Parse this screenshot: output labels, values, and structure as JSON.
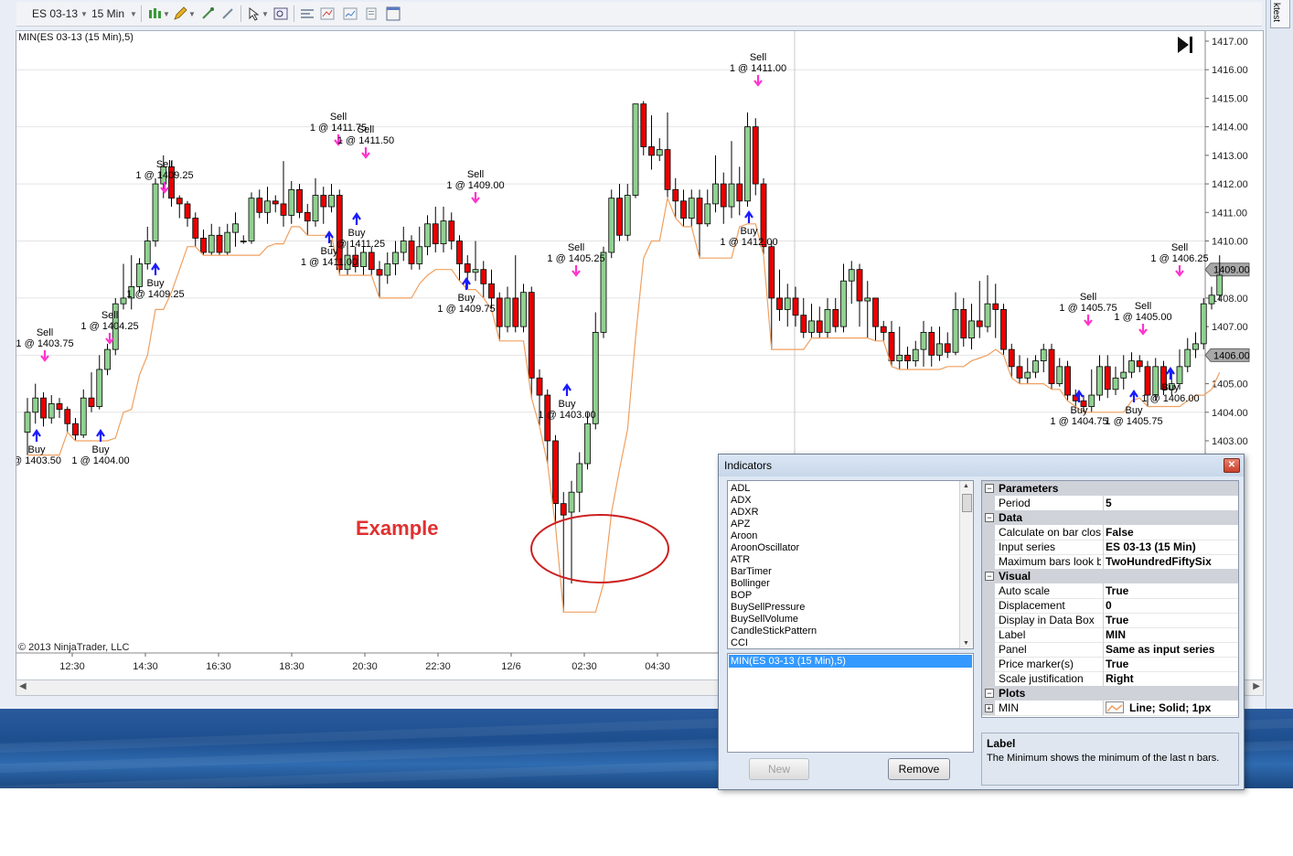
{
  "toolbar": {
    "instrument": "ES 03-13",
    "interval": "15 Min"
  },
  "right_tab": "ktest",
  "chart": {
    "indicator_label": "MIN(ES 03-13 (15 Min),5)",
    "copyright": "© 2013 NinjaTrader, LLC",
    "watermark": "Example",
    "price_ticks": [
      "1417.00",
      "1416.00",
      "1415.00",
      "1414.00",
      "1413.00",
      "1412.00",
      "1411.00",
      "1410.00",
      "1409.00",
      "1408.00",
      "1407.00",
      "1406.00",
      "1405.00",
      "1404.00",
      "1403.00"
    ],
    "price_markers": [
      "1409.00",
      "1406.00"
    ],
    "time_ticks": [
      "12:30",
      "14:30",
      "16:30",
      "18:30",
      "20:30",
      "22:30",
      "12/6",
      "02:30",
      "04:30"
    ],
    "trade_labels": [
      {
        "l1": "Sell",
        "l2": "1 @ 1403.75"
      },
      {
        "l1": "Buy",
        "l2": "@ 1403.50"
      },
      {
        "l1": "Buy",
        "l2": "1 @ 1404.00"
      },
      {
        "l1": "Sell",
        "l2": "1 @ 1404.25"
      },
      {
        "l1": "Sell",
        "l2": "1 @ 1409.25"
      },
      {
        "l1": "Buy",
        "l2": "1 @ 1409.25"
      },
      {
        "l1": "Sell",
        "l2": "1 @ 1411.75"
      },
      {
        "l1": "Sell",
        "l2": "1 @ 1411.50"
      },
      {
        "l1": "Buy",
        "l2": "1 @ 1411.00"
      },
      {
        "l1": "Buy",
        "l2": "1 @ 1411.25"
      },
      {
        "l1": "Sell",
        "l2": "1 @ 1409.00"
      },
      {
        "l1": "Buy",
        "l2": "1 @ 1409.75"
      },
      {
        "l1": "Sell",
        "l2": "1 @ 1405.25"
      },
      {
        "l1": "Buy",
        "l2": "1 @ 1403.00"
      },
      {
        "l1": "Sell",
        "l2": "1 @ 1411.00"
      },
      {
        "l1": "Buy",
        "l2": "1 @ 1412.00"
      },
      {
        "l1": "Sell",
        "l2": "1 @ 1405.75"
      },
      {
        "l1": "Buy",
        "l2": "1 @ 1404.75"
      },
      {
        "l1": "Sell",
        "l2": "1 @ 1405.00"
      },
      {
        "l1": "Buy",
        "l2": "1 @ 1405.75"
      },
      {
        "l1": "Sell",
        "l2": "1 @ 1406.25"
      },
      {
        "l1": "Buy",
        "l2": "1 @ 1406.00"
      }
    ],
    "colors": {
      "up": "#8fd18f",
      "down": "#e60000",
      "min_line": "#f0a060",
      "sell_arrow": "#ff33cc",
      "buy_arrow": "#1a1aff"
    }
  },
  "chart_data": {
    "type": "candlestick",
    "instrument": "ES 03-13",
    "interval": "15 Min",
    "ylim": [
      1402.5,
      1417.2
    ],
    "bars": [
      {
        "o": 1403.3,
        "c": 1404.0,
        "h": 1404.5,
        "l": 1402.5
      },
      {
        "o": 1404.0,
        "c": 1404.5,
        "h": 1405.0,
        "l": 1403.6
      },
      {
        "o": 1404.5,
        "c": 1403.8,
        "h": 1404.7,
        "l": 1403.5
      },
      {
        "o": 1403.8,
        "c": 1404.3,
        "h": 1404.6,
        "l": 1403.6
      },
      {
        "o": 1404.3,
        "c": 1404.1,
        "h": 1404.5,
        "l": 1403.8
      },
      {
        "o": 1404.1,
        "c": 1403.6,
        "h": 1404.2,
        "l": 1403.3
      },
      {
        "o": 1403.6,
        "c": 1403.2,
        "h": 1403.8,
        "l": 1403.0
      },
      {
        "o": 1403.2,
        "c": 1404.5,
        "h": 1404.8,
        "l": 1403.1
      },
      {
        "o": 1404.5,
        "c": 1404.2,
        "h": 1405.4,
        "l": 1404.0
      },
      {
        "o": 1404.2,
        "c": 1405.5,
        "h": 1406.0,
        "l": 1404.1
      },
      {
        "o": 1405.5,
        "c": 1406.2,
        "h": 1406.4,
        "l": 1405.3
      },
      {
        "o": 1406.2,
        "c": 1407.8,
        "h": 1408.0,
        "l": 1406.0
      },
      {
        "o": 1407.8,
        "c": 1408.0,
        "h": 1409.2,
        "l": 1407.6
      },
      {
        "o": 1408.0,
        "c": 1408.4,
        "h": 1409.5,
        "l": 1407.6
      },
      {
        "o": 1408.4,
        "c": 1409.2,
        "h": 1409.4,
        "l": 1408.2
      },
      {
        "o": 1409.2,
        "c": 1410.0,
        "h": 1410.5,
        "l": 1409.0
      },
      {
        "o": 1410.0,
        "c": 1412.0,
        "h": 1412.2,
        "l": 1409.8
      },
      {
        "o": 1412.0,
        "c": 1412.6,
        "h": 1413.0,
        "l": 1411.5
      },
      {
        "o": 1412.6,
        "c": 1411.5,
        "h": 1412.8,
        "l": 1411.2
      },
      {
        "o": 1411.5,
        "c": 1411.3,
        "h": 1411.6,
        "l": 1410.8
      },
      {
        "o": 1411.3,
        "c": 1410.8,
        "h": 1411.4,
        "l": 1410.5
      },
      {
        "o": 1410.8,
        "c": 1410.1,
        "h": 1411.0,
        "l": 1409.8
      },
      {
        "o": 1410.1,
        "c": 1409.6,
        "h": 1410.4,
        "l": 1409.5
      },
      {
        "o": 1409.6,
        "c": 1410.2,
        "h": 1410.6,
        "l": 1409.5
      },
      {
        "o": 1410.2,
        "c": 1409.6,
        "h": 1410.5,
        "l": 1409.5
      },
      {
        "o": 1409.6,
        "c": 1410.3,
        "h": 1410.6,
        "l": 1409.5
      },
      {
        "o": 1410.3,
        "c": 1410.6,
        "h": 1411.0,
        "l": 1409.8
      },
      {
        "o": 1410.0,
        "c": 1410.0,
        "h": 1410.2,
        "l": 1409.9
      },
      {
        "o": 1410.0,
        "c": 1411.5,
        "h": 1411.7,
        "l": 1409.9
      },
      {
        "o": 1411.5,
        "c": 1411.0,
        "h": 1411.8,
        "l": 1410.8
      },
      {
        "o": 1411.0,
        "c": 1411.4,
        "h": 1411.9,
        "l": 1410.6
      },
      {
        "o": 1411.4,
        "c": 1411.3,
        "h": 1411.6,
        "l": 1411.0
      },
      {
        "o": 1411.3,
        "c": 1410.9,
        "h": 1412.8,
        "l": 1410.5
      },
      {
        "o": 1410.9,
        "c": 1411.8,
        "h": 1412.1,
        "l": 1410.6
      },
      {
        "o": 1411.8,
        "c": 1411.0,
        "h": 1412.0,
        "l": 1410.8
      },
      {
        "o": 1411.0,
        "c": 1410.7,
        "h": 1411.3,
        "l": 1410.2
      },
      {
        "o": 1410.7,
        "c": 1411.6,
        "h": 1412.2,
        "l": 1410.5
      },
      {
        "o": 1411.6,
        "c": 1411.2,
        "h": 1411.9,
        "l": 1410.6
      },
      {
        "o": 1411.2,
        "c": 1411.6,
        "h": 1412.0,
        "l": 1411.0
      },
      {
        "o": 1411.6,
        "c": 1409.0,
        "h": 1411.8,
        "l": 1408.8
      },
      {
        "o": 1409.0,
        "c": 1409.5,
        "h": 1410.0,
        "l": 1408.8
      },
      {
        "o": 1409.5,
        "c": 1409.1,
        "h": 1409.8,
        "l": 1408.9
      },
      {
        "o": 1409.1,
        "c": 1409.6,
        "h": 1409.8,
        "l": 1408.8
      },
      {
        "o": 1409.6,
        "c": 1409.0,
        "h": 1409.8,
        "l": 1408.8
      },
      {
        "o": 1409.0,
        "c": 1408.8,
        "h": 1409.3,
        "l": 1408.0
      },
      {
        "o": 1408.8,
        "c": 1409.2,
        "h": 1409.6,
        "l": 1408.5
      },
      {
        "o": 1409.2,
        "c": 1409.6,
        "h": 1410.0,
        "l": 1408.8
      },
      {
        "o": 1409.6,
        "c": 1410.0,
        "h": 1410.5,
        "l": 1409.3
      },
      {
        "o": 1410.0,
        "c": 1409.2,
        "h": 1410.2,
        "l": 1409.0
      },
      {
        "o": 1409.2,
        "c": 1409.8,
        "h": 1410.5,
        "l": 1409.0
      },
      {
        "o": 1409.8,
        "c": 1410.6,
        "h": 1410.9,
        "l": 1409.5
      },
      {
        "o": 1410.6,
        "c": 1409.9,
        "h": 1411.2,
        "l": 1409.6
      },
      {
        "o": 1409.9,
        "c": 1410.7,
        "h": 1411.2,
        "l": 1409.6
      },
      {
        "o": 1410.7,
        "c": 1410.0,
        "h": 1411.0,
        "l": 1409.7
      },
      {
        "o": 1410.0,
        "c": 1409.2,
        "h": 1410.2,
        "l": 1408.6
      },
      {
        "o": 1409.2,
        "c": 1408.9,
        "h": 1409.5,
        "l": 1408.3
      },
      {
        "o": 1408.9,
        "c": 1409.0,
        "h": 1410.0,
        "l": 1408.6
      },
      {
        "o": 1409.0,
        "c": 1408.5,
        "h": 1409.3,
        "l": 1408.0
      },
      {
        "o": 1408.5,
        "c": 1408.0,
        "h": 1409.0,
        "l": 1407.6
      },
      {
        "o": 1408.0,
        "c": 1407.0,
        "h": 1408.2,
        "l": 1406.5
      },
      {
        "o": 1407.0,
        "c": 1408.0,
        "h": 1408.4,
        "l": 1406.8
      },
      {
        "o": 1408.0,
        "c": 1407.0,
        "h": 1409.5,
        "l": 1406.8
      },
      {
        "o": 1407.0,
        "c": 1408.2,
        "h": 1408.5,
        "l": 1406.8
      },
      {
        "o": 1408.2,
        "c": 1405.2,
        "h": 1408.4,
        "l": 1404.5
      },
      {
        "o": 1405.2,
        "c": 1404.6,
        "h": 1405.5,
        "l": 1403.5
      },
      {
        "o": 1404.6,
        "c": 1403.0,
        "h": 1404.8,
        "l": 1402.2
      },
      {
        "o": 1403.0,
        "c": 1400.8,
        "h": 1403.2,
        "l": 1400.0
      },
      {
        "o": 1400.8,
        "c": 1400.4,
        "h": 1401.2,
        "l": 1397.0
      },
      {
        "o": 1400.5,
        "c": 1401.2,
        "h": 1401.6,
        "l": 1398.0
      },
      {
        "o": 1401.2,
        "c": 1402.2,
        "h": 1402.6,
        "l": 1400.5
      },
      {
        "o": 1402.2,
        "c": 1403.6,
        "h": 1404.0,
        "l": 1402.0
      },
      {
        "o": 1403.6,
        "c": 1406.8,
        "h": 1407.5,
        "l": 1403.4
      },
      {
        "o": 1406.8,
        "c": 1409.6,
        "h": 1409.8,
        "l": 1406.6
      },
      {
        "o": 1409.6,
        "c": 1411.5,
        "h": 1411.8,
        "l": 1409.4
      },
      {
        "o": 1411.5,
        "c": 1410.2,
        "h": 1412.0,
        "l": 1410.0
      },
      {
        "o": 1410.2,
        "c": 1411.6,
        "h": 1412.0,
        "l": 1410.0
      },
      {
        "o": 1411.6,
        "c": 1414.8,
        "h": 1414.8,
        "l": 1411.5
      },
      {
        "o": 1414.8,
        "c": 1413.3,
        "h": 1414.9,
        "l": 1413.0
      },
      {
        "o": 1413.3,
        "c": 1413.0,
        "h": 1414.4,
        "l": 1412.5
      },
      {
        "o": 1413.0,
        "c": 1413.2,
        "h": 1413.6,
        "l": 1412.8
      },
      {
        "o": 1413.2,
        "c": 1411.8,
        "h": 1414.5,
        "l": 1411.5
      },
      {
        "o": 1411.8,
        "c": 1411.4,
        "h": 1412.2,
        "l": 1410.8
      },
      {
        "o": 1411.4,
        "c": 1410.8,
        "h": 1411.8,
        "l": 1410.5
      },
      {
        "o": 1410.8,
        "c": 1411.5,
        "h": 1411.8,
        "l": 1410.5
      },
      {
        "o": 1411.5,
        "c": 1410.6,
        "h": 1411.8,
        "l": 1409.4
      },
      {
        "o": 1410.6,
        "c": 1411.3,
        "h": 1411.8,
        "l": 1410.5
      },
      {
        "o": 1411.3,
        "c": 1412.0,
        "h": 1413.0,
        "l": 1411.0
      },
      {
        "o": 1412.0,
        "c": 1411.2,
        "h": 1412.4,
        "l": 1410.6
      },
      {
        "o": 1411.2,
        "c": 1412.0,
        "h": 1413.5,
        "l": 1410.8
      },
      {
        "o": 1412.0,
        "c": 1411.4,
        "h": 1412.6,
        "l": 1410.9
      },
      {
        "o": 1411.4,
        "c": 1414.0,
        "h": 1414.5,
        "l": 1411.2
      },
      {
        "o": 1414.0,
        "c": 1412.0,
        "h": 1414.3,
        "l": 1411.6
      },
      {
        "o": 1412.0,
        "c": 1409.8,
        "h": 1412.2,
        "l": 1409.5
      },
      {
        "o": 1409.8,
        "c": 1408.0,
        "h": 1410.0,
        "l": 1406.2
      },
      {
        "o": 1408.0,
        "c": 1407.6,
        "h": 1409.0,
        "l": 1407.2
      },
      {
        "o": 1407.6,
        "c": 1408.0,
        "h": 1408.5,
        "l": 1407.0
      },
      {
        "o": 1408.0,
        "c": 1407.4,
        "h": 1408.4,
        "l": 1407.0
      },
      {
        "o": 1407.4,
        "c": 1406.8,
        "h": 1408.0,
        "l": 1406.6
      },
      {
        "o": 1406.8,
        "c": 1407.2,
        "h": 1407.8,
        "l": 1406.6
      },
      {
        "o": 1407.2,
        "c": 1406.8,
        "h": 1407.7,
        "l": 1406.6
      },
      {
        "o": 1406.8,
        "c": 1407.6,
        "h": 1408.0,
        "l": 1406.6
      },
      {
        "o": 1407.6,
        "c": 1407.0,
        "h": 1408.0,
        "l": 1406.8
      },
      {
        "o": 1407.0,
        "c": 1408.6,
        "h": 1409.2,
        "l": 1406.8
      },
      {
        "o": 1408.6,
        "c": 1409.0,
        "h": 1409.3,
        "l": 1407.8
      },
      {
        "o": 1409.0,
        "c": 1407.9,
        "h": 1409.2,
        "l": 1407.0
      },
      {
        "o": 1407.9,
        "c": 1408.0,
        "h": 1408.6,
        "l": 1406.6
      },
      {
        "o": 1408.0,
        "c": 1407.0,
        "h": 1408.0,
        "l": 1406.5
      },
      {
        "o": 1407.0,
        "c": 1406.8,
        "h": 1407.2,
        "l": 1406.5
      },
      {
        "o": 1406.8,
        "c": 1405.8,
        "h": 1407.2,
        "l": 1405.6
      },
      {
        "o": 1405.8,
        "c": 1406.0,
        "h": 1407.0,
        "l": 1405.5
      },
      {
        "o": 1406.0,
        "c": 1405.8,
        "h": 1406.3,
        "l": 1405.5
      },
      {
        "o": 1405.8,
        "c": 1406.2,
        "h": 1406.5,
        "l": 1405.6
      },
      {
        "o": 1406.2,
        "c": 1406.8,
        "h": 1407.2,
        "l": 1405.6
      },
      {
        "o": 1406.8,
        "c": 1406.0,
        "h": 1407.0,
        "l": 1405.6
      },
      {
        "o": 1406.0,
        "c": 1406.4,
        "h": 1407.0,
        "l": 1405.8
      },
      {
        "o": 1406.4,
        "c": 1406.1,
        "h": 1406.8,
        "l": 1405.9
      },
      {
        "o": 1406.1,
        "c": 1407.6,
        "h": 1408.2,
        "l": 1406.0
      },
      {
        "o": 1407.6,
        "c": 1406.6,
        "h": 1408.0,
        "l": 1406.3
      },
      {
        "o": 1406.6,
        "c": 1407.2,
        "h": 1407.8,
        "l": 1406.2
      },
      {
        "o": 1407.2,
        "c": 1407.0,
        "h": 1408.6,
        "l": 1406.6
      },
      {
        "o": 1407.0,
        "c": 1407.8,
        "h": 1408.8,
        "l": 1406.8
      },
      {
        "o": 1407.8,
        "c": 1407.6,
        "h": 1408.5,
        "l": 1406.6
      },
      {
        "o": 1407.6,
        "c": 1406.2,
        "h": 1407.8,
        "l": 1406.0
      },
      {
        "o": 1406.2,
        "c": 1405.6,
        "h": 1406.4,
        "l": 1405.2
      },
      {
        "o": 1405.6,
        "c": 1405.2,
        "h": 1406.0,
        "l": 1405.0
      },
      {
        "o": 1405.2,
        "c": 1405.4,
        "h": 1405.9,
        "l": 1405.0
      },
      {
        "o": 1405.4,
        "c": 1405.8,
        "h": 1406.0,
        "l": 1405.2
      },
      {
        "o": 1405.8,
        "c": 1406.2,
        "h": 1406.4,
        "l": 1405.4
      },
      {
        "o": 1406.2,
        "c": 1405.0,
        "h": 1406.4,
        "l": 1404.8
      },
      {
        "o": 1405.0,
        "c": 1405.6,
        "h": 1405.9,
        "l": 1404.9
      },
      {
        "o": 1405.6,
        "c": 1404.6,
        "h": 1405.8,
        "l": 1404.4
      },
      {
        "o": 1404.6,
        "c": 1404.4,
        "h": 1404.8,
        "l": 1404.2
      },
      {
        "o": 1404.4,
        "c": 1404.2,
        "h": 1404.6,
        "l": 1404.0
      },
      {
        "o": 1404.2,
        "c": 1404.6,
        "h": 1405.5,
        "l": 1404.0
      },
      {
        "o": 1404.6,
        "c": 1405.6,
        "h": 1406.0,
        "l": 1404.4
      },
      {
        "o": 1405.6,
        "c": 1404.8,
        "h": 1406.0,
        "l": 1404.5
      },
      {
        "o": 1404.8,
        "c": 1405.2,
        "h": 1405.6,
        "l": 1404.6
      },
      {
        "o": 1405.2,
        "c": 1405.4,
        "h": 1406.0,
        "l": 1404.8
      },
      {
        "o": 1405.4,
        "c": 1405.8,
        "h": 1406.1,
        "l": 1405.2
      },
      {
        "o": 1405.8,
        "c": 1405.6,
        "h": 1406.0,
        "l": 1405.4
      },
      {
        "o": 1405.6,
        "c": 1404.6,
        "h": 1405.8,
        "l": 1404.2
      },
      {
        "o": 1404.6,
        "c": 1405.6,
        "h": 1405.9,
        "l": 1404.4
      },
      {
        "o": 1405.6,
        "c": 1404.8,
        "h": 1405.8,
        "l": 1404.6
      },
      {
        "o": 1404.8,
        "c": 1405.0,
        "h": 1405.4,
        "l": 1404.6
      },
      {
        "o": 1405.0,
        "c": 1405.6,
        "h": 1406.2,
        "l": 1404.8
      },
      {
        "o": 1405.6,
        "c": 1406.2,
        "h": 1406.6,
        "l": 1405.4
      },
      {
        "o": 1406.2,
        "c": 1406.4,
        "h": 1406.8,
        "l": 1405.9
      },
      {
        "o": 1406.4,
        "c": 1407.8,
        "h": 1408.0,
        "l": 1406.2
      },
      {
        "o": 1407.8,
        "c": 1408.1,
        "h": 1408.4,
        "l": 1407.6
      },
      {
        "o": 1408.1,
        "c": 1408.8,
        "h": 1409.5,
        "l": 1407.9
      }
    ],
    "min_period": 5,
    "series": [
      {
        "name": "MIN(ES 03-13 (15 Min),5)"
      }
    ]
  },
  "dialog": {
    "title": "Indicators",
    "indicators": [
      "ADL",
      "ADX",
      "ADXR",
      "APZ",
      "Aroon",
      "AroonOscillator",
      "ATR",
      "BarTimer",
      "Bollinger",
      "BOP",
      "BuySellPressure",
      "BuySellVolume",
      "CandleStickPattern",
      "CCI"
    ],
    "selected": "MIN(ES 03-13 (15 Min),5)",
    "new_label": "New",
    "remove_label": "Remove",
    "categories": {
      "parameters": "Parameters",
      "data": "Data",
      "visual": "Visual",
      "plots": "Plots"
    },
    "params": [
      {
        "name": "Period",
        "value": "5"
      }
    ],
    "data_rows": [
      {
        "name": "Calculate on bar close",
        "value": "False"
      },
      {
        "name": "Input series",
        "value": "ES 03-13 (15 Min)"
      },
      {
        "name": "Maximum bars look ba",
        "value": "TwoHundredFiftySix"
      }
    ],
    "visual_rows": [
      {
        "name": "Auto scale",
        "value": "True"
      },
      {
        "name": "Displacement",
        "value": "0"
      },
      {
        "name": "Display in Data Box",
        "value": "True"
      },
      {
        "name": "Label",
        "value": "MIN"
      },
      {
        "name": "Panel",
        "value": "Same as input series"
      },
      {
        "name": "Price marker(s)",
        "value": "True"
      },
      {
        "name": "Scale justification",
        "value": "Right"
      }
    ],
    "plot_row": {
      "name": "MIN",
      "value": "Line; Solid; 1px"
    },
    "desc_title": "Label",
    "desc_text": "The Minimum shows the minimum of the last n bars."
  }
}
